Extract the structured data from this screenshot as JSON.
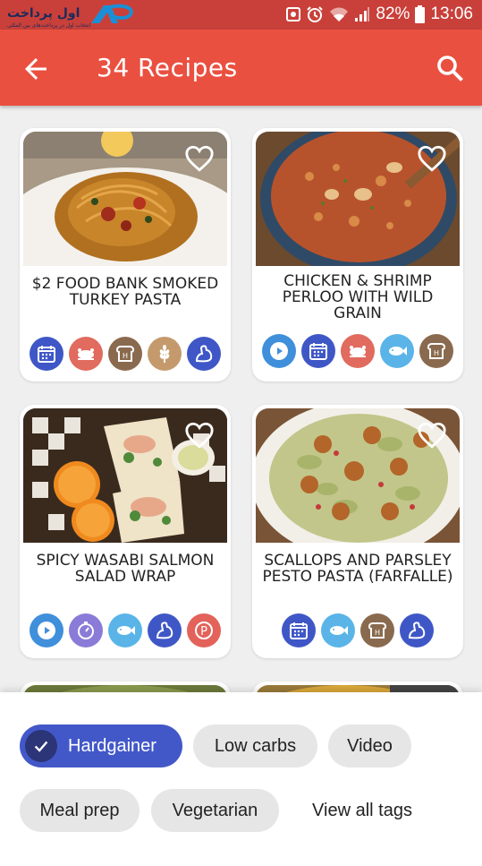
{
  "status_bar": {
    "battery": "82%",
    "time": "13:06",
    "logo_text": "اول پرداخت",
    "logo_caption": "انتخاب اول در پرداخت‌های بین المللی"
  },
  "app_bar": {
    "title": "34 Recipes"
  },
  "recipes": [
    {
      "title": "$2 FOOD BANK SMOKED TURKEY PASTA",
      "tags": [
        "calendar-icon",
        "chicken-icon",
        "bread-icon",
        "wheat-icon",
        "muscle-icon"
      ]
    },
    {
      "title": "CHICKEN & SHRIMP PERLOO WITH WILD GRAIN",
      "tags": [
        "video-icon",
        "calendar-icon",
        "chicken-icon",
        "fish-icon",
        "bread-icon"
      ]
    },
    {
      "title": "SPICY WASABI SALMON SALAD WRAP",
      "tags": [
        "video-icon",
        "timer-icon",
        "fish-icon",
        "muscle-icon",
        "protein-icon"
      ]
    },
    {
      "title": "SCALLOPS AND PARSLEY PESTO PASTA (FARFALLE)",
      "tags": [
        "calendar-icon",
        "fish-icon",
        "bread-icon",
        "muscle-icon"
      ]
    }
  ],
  "filters": {
    "chips": [
      {
        "label": "Hardgainer",
        "selected": true
      },
      {
        "label": "Low carbs",
        "selected": false
      },
      {
        "label": "Video",
        "selected": false
      },
      {
        "label": "Meal prep",
        "selected": false
      },
      {
        "label": "Vegetarian",
        "selected": false
      }
    ],
    "view_all": "View all tags"
  },
  "colors": {
    "app_bar": "#ea5040",
    "status_bar": "#c9403a",
    "chip_selected": "#4358c8",
    "tag_calendar": "#3f57c6",
    "tag_chicken": "#e06b5e",
    "tag_bread": "#8a6a4e",
    "tag_wheat": "#c49a6c",
    "tag_muscle": "#3f57c6",
    "tag_video": "#3f8fdb",
    "tag_fish": "#5ab4e8",
    "tag_timer": "#8b7bd8",
    "tag_protein": "#e3625a"
  }
}
